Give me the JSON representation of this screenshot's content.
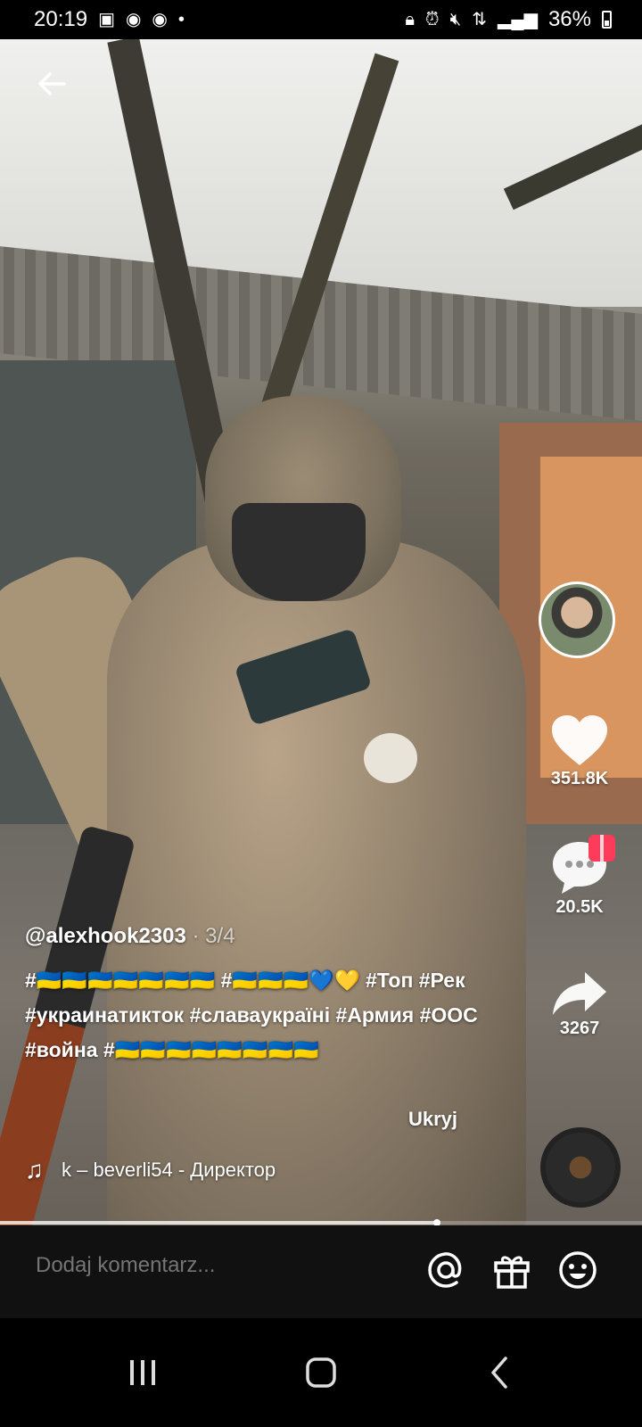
{
  "status_bar": {
    "time": "20:19",
    "battery": "36%",
    "left_icons": [
      "gallery-icon",
      "chrome-icon",
      "chrome-icon",
      "dot-icon"
    ],
    "right_icons": [
      "lock-icon",
      "alarm-icon",
      "mute-icon",
      "data-icon",
      "signal-icon"
    ]
  },
  "video": {
    "author": "@alexhook2303",
    "part": "· 3/4",
    "caption": "#🇺🇦🇺🇦🇺🇦🇺🇦🇺🇦🇺🇦🇺🇦 #🇺🇦🇺🇦🇺🇦💙💛 #Топ #Рек #украинатикток #славаукраїні #Армия #ООС #война #🇺🇦🇺🇦🇺🇦🇺🇦🇺🇦🇺🇦🇺🇦🇺🇦",
    "translate_label": "Ukryj",
    "music": "k – beverli54 - Директор",
    "progress": 0.68
  },
  "actions": {
    "likes": "351.8K",
    "comments": "20.5K",
    "shares": "3267"
  },
  "comment_bar": {
    "placeholder": "Dodaj komentarz..."
  },
  "colors": {
    "gift_badge": "#ff3b5c",
    "comment_bar_bg": "#111111"
  }
}
